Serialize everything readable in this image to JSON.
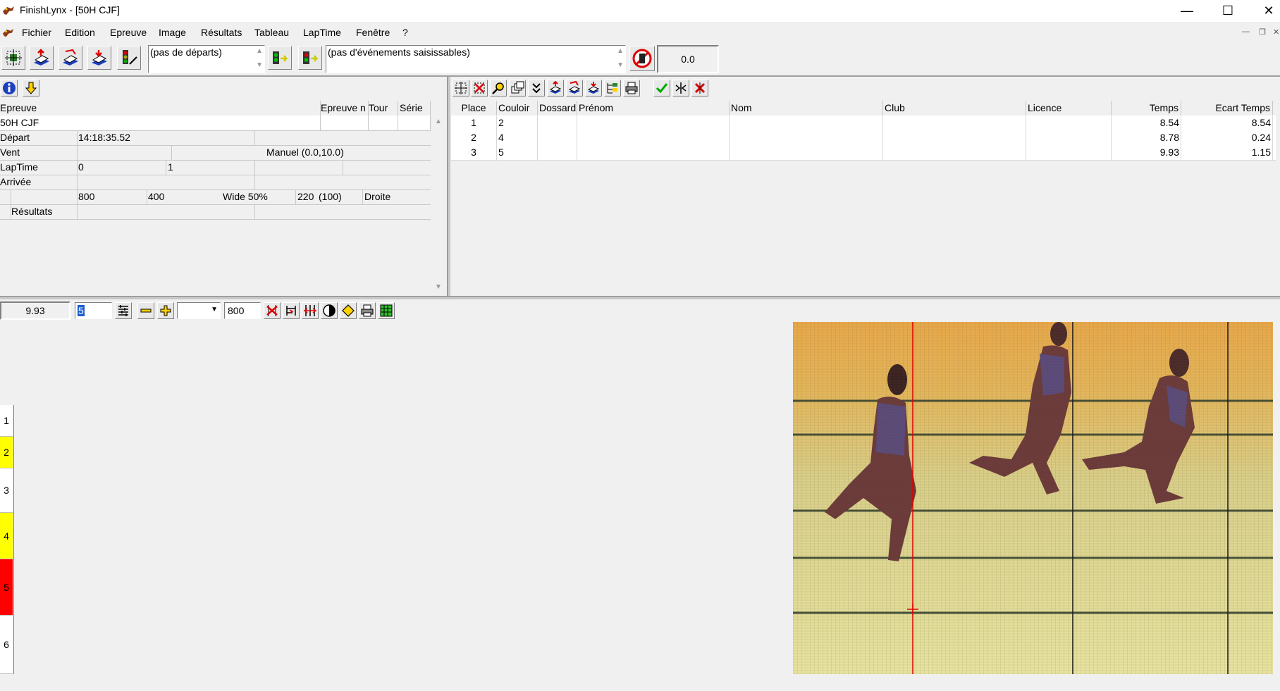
{
  "window": {
    "title": "FinishLynx - [50H CJF]",
    "minimize_glyph": "—",
    "maximize_glyph": "☐",
    "close_glyph": "✕"
  },
  "menu": {
    "items": [
      "Fichier",
      "Edition",
      "Epreuve",
      "Image",
      "Résultats",
      "Tableau",
      "LapTime",
      "Fenêtre",
      "?"
    ]
  },
  "toolbar": {
    "departures_text": "(pas de départs)",
    "events_text": "(pas d'événements saisissables)",
    "wind_value": "0.0"
  },
  "event_info": {
    "headers": {
      "epreuve": "Epreuve",
      "epreuve_n": "Epreuve n",
      "tour": "Tour",
      "serie": "Série"
    },
    "event_name": "50H CJF",
    "rows": {
      "depart_label": "Départ",
      "depart_time": "14:18:35.52",
      "vent_label": "Vent",
      "vent_value": "Manuel (0.0,10.0)",
      "laptime_label": "LapTime",
      "laptime_val1": "0",
      "laptime_val2": "1",
      "arrivee_label": "Arrivée",
      "cam_val1": "800",
      "cam_val2": "400",
      "cam_val3": "Wide 50%",
      "cam_val4": "220",
      "cam_val5": "(100)",
      "cam_val6": "Droite",
      "resultats_label": "Résultats"
    }
  },
  "results": {
    "columns": [
      "Place",
      "Couloir",
      "Dossard",
      "Prénom",
      "Nom",
      "Club",
      "Licence",
      "Temps",
      "Ecart Temps"
    ],
    "rows": [
      {
        "place": "1",
        "couloir": "2",
        "dossard": "",
        "prenom": "",
        "nom": "",
        "club": "",
        "licence": "",
        "temps": "8.54",
        "ecart": "8.54"
      },
      {
        "place": "2",
        "couloir": "4",
        "dossard": "",
        "prenom": "",
        "nom": "",
        "club": "",
        "licence": "",
        "temps": "8.78",
        "ecart": "0.24"
      },
      {
        "place": "3",
        "couloir": "5",
        "dossard": "",
        "prenom": "",
        "nom": "",
        "club": "",
        "licence": "",
        "temps": "9.93",
        "ecart": "1.15"
      }
    ]
  },
  "image_toolbar": {
    "time_value": "9.93",
    "lane_field_value": "5",
    "zoom_select_value": "",
    "density_value": "800"
  },
  "lanes": [
    {
      "label": "1",
      "color": "#ffffff"
    },
    {
      "label": "2",
      "color": "#ffff00"
    },
    {
      "label": "3",
      "color": "#ffffff"
    },
    {
      "label": "4",
      "color": "#ffff00"
    },
    {
      "label": "5",
      "color": "#ff0000"
    },
    {
      "label": "6",
      "color": "#ffffff"
    }
  ],
  "colors": {
    "accent_red": "#e00000",
    "lane_yellow": "#ffff00",
    "lane_red": "#ff0000"
  }
}
